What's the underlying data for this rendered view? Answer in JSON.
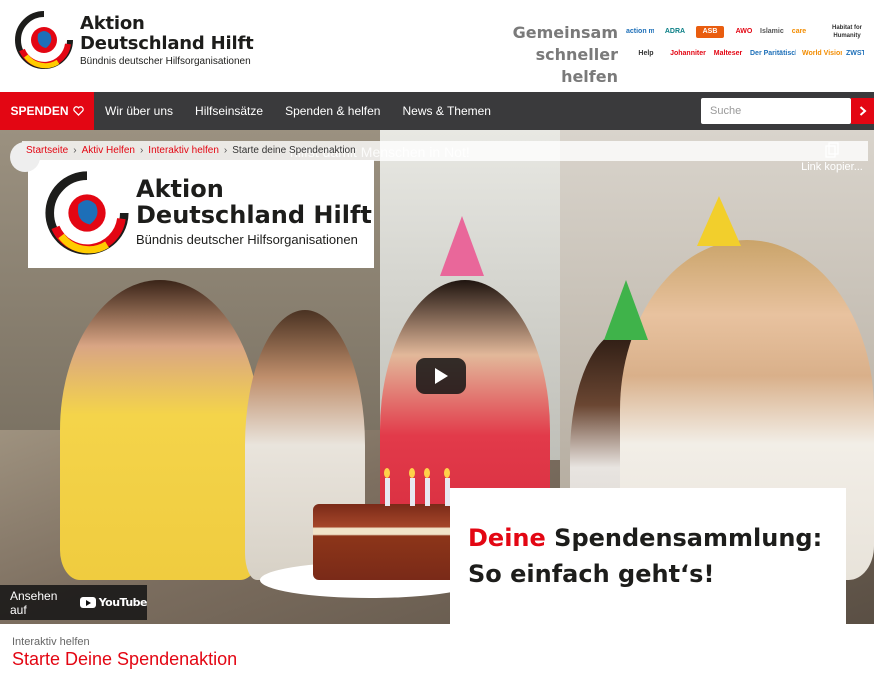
{
  "header": {
    "logo": {
      "line1": "Aktion",
      "line2": "Deutschland Hilft",
      "sub": "Bündnis deutscher Hilfsorganisationen"
    },
    "tagline": {
      "line1": "Gemeinsam",
      "line2": "schneller helfen"
    },
    "partners": [
      "action medeor",
      "ADRA",
      "ASB",
      "AWO",
      "Islamic Relief",
      "care",
      "Habitat for Humanity",
      "Help",
      "Johanniter",
      "Malteser",
      "Der Paritätische",
      "World Vision",
      "ZWST"
    ]
  },
  "nav": {
    "spenden_label": "SPENDEN",
    "items": [
      "Wir über uns",
      "Hilfseinsätze",
      "Spenden & helfen",
      "News & Themen"
    ],
    "search_placeholder": "Suche"
  },
  "breadcrumb": {
    "items": [
      "Startseite",
      "Aktiv Helfen",
      "Interaktiv helfen"
    ],
    "current": "Starte deine Spendenaktion"
  },
  "video": {
    "title_overlay": "hilfst damit Menschen in Not!",
    "copy_link_label": "Link kopier...",
    "logo": {
      "line1": "Aktion",
      "line2": "Deutschland Hilft",
      "sub": "Bündnis deutscher Hilfsorganisationen"
    },
    "tagline": {
      "red": "Deine",
      "rest": " Spendensammlung:",
      "line2": "So einfach geht‘s!"
    },
    "watch_on_label": "Ansehen auf",
    "youtube_label": "YouTube"
  },
  "page": {
    "kicker": "Interaktiv helfen",
    "heading": "Starte Deine Spendenaktion"
  },
  "colors": {
    "accent": "#e30613",
    "nav_bg": "#3a3a3c"
  }
}
